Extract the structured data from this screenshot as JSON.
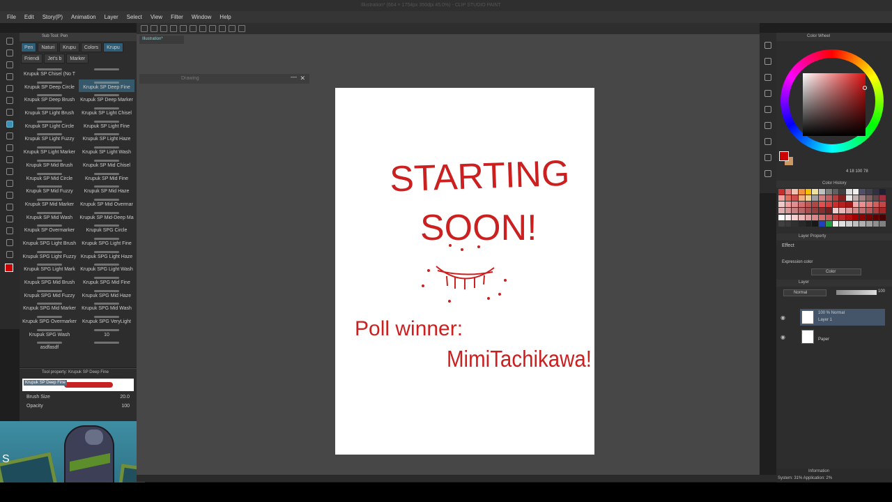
{
  "titlebar": {
    "text": "Illustration* (664 × 1754px 350dpi 45.0%) - CLIP STUDIO PAINT"
  },
  "menu": [
    "File",
    "Edit",
    "Story(P)",
    "Animation",
    "Layer",
    "Select",
    "View",
    "Filter",
    "Window",
    "Help"
  ],
  "document_tab": "Illustration*",
  "floating_window": {
    "title": "Drawing",
    "close": "✕",
    "minimize": "—"
  },
  "subtool": {
    "header": "Sub Tool: Pen",
    "tabs": [
      "Pen",
      "Naturi",
      "Krupu",
      "Colors",
      "Krupu",
      "Friendi",
      "Jet's b",
      "Marker"
    ],
    "active_tab_indices": [
      0,
      4
    ],
    "brushes": [
      [
        "Krupuk SP Chisel (No T",
        ""
      ],
      [
        "Krupuk SP Deep Circle",
        "Krupuk SP Deep Fine"
      ],
      [
        "Krupuk SP Deep Brush",
        "Krupuk SP Deep Marker"
      ],
      [
        "Krupuk SP Light Brush",
        "Krupuk SP Light Chisel"
      ],
      [
        "Krupuk SP Light Circle",
        "Krupuk SP Light Fine"
      ],
      [
        "Krupuk SP Light Fuzzy",
        "Krupuk SP Light Haze"
      ],
      [
        "Krupuk SP Light Marker",
        "Krupuk SP Light Wash"
      ],
      [
        "Krupuk SP Mid Brush",
        "Krupuk SP Mid Chisel"
      ],
      [
        "Krupuk SP Mid Circle",
        "Krupuk SP Mid Fine"
      ],
      [
        "Krupuk SP Mid Fuzzy",
        "Krupuk SP Mid Haze"
      ],
      [
        "Krupuk SP Mid Marker",
        "Krupuk SP Mid Overmar"
      ],
      [
        "Krupuk SP Mid Wash",
        "Krupuk SP Mid-Deep Ma"
      ],
      [
        "Krupuk SP Overmarker",
        "Krupuk SPG Circle"
      ],
      [
        "Krupuk SPG Light Brush",
        "Krupuk SPG Light Fine"
      ],
      [
        "Krupuk SPG Light Fuzzy",
        "Krupuk SPG Light Haze"
      ],
      [
        "Krupuk SPG Light Mark",
        "Krupuk SPG Light Wash"
      ],
      [
        "Krupuk SPG Mid Brush",
        "Krupuk SPG Mid Fine"
      ],
      [
        "Krupuk SPG Mid Fuzzy",
        "Krupuk SPG Mid Haze"
      ],
      [
        "Krupuk SPG Mid Marker",
        "Krupuk SPG Mid Wash"
      ],
      [
        "Krupuk SPG Overmarker",
        "Krupuk SPG VeryLight"
      ],
      [
        "Krupuk SPG Wash",
        "10"
      ],
      [
        "asdfasdf",
        ""
      ]
    ]
  },
  "tool_property": {
    "title": "Tool property: Krupuk SP Deep Fine",
    "brush_name": "Krupuk SP Deep Fine",
    "brush_size_label": "Brush Size",
    "brush_size_value": "20.0",
    "opacity_label": "Opacity",
    "opacity_value": "100"
  },
  "webcam": {
    "overlay_letter": "S"
  },
  "canvas": {
    "line1": "STARTING",
    "line2": "SOON!",
    "line3": "Poll winner:",
    "line4": "MimiTachikawa!",
    "ink_color": "#cc1f1f"
  },
  "color_panel": {
    "header": "Color Wheel",
    "rgb_readout": "4  18  100  78",
    "palette_header": "Color History",
    "palette": [
      "#c83030",
      "#e08080",
      "#f0c0b0",
      "#f09040",
      "#f8c000",
      "#f0e0a0",
      "#c0c0c0",
      "#808080",
      "#606060",
      "#404040",
      "#e0e0e0",
      "#f0f0f0",
      "#505068",
      "#404050",
      "#303040",
      "#202030",
      "#f4a0a0",
      "#e07060",
      "#d05050",
      "#f0b080",
      "#f0d090",
      "#a0a0a0",
      "#d08080",
      "#c06060",
      "#b04040",
      "#802020",
      "#e8e8e8",
      "#c0b0b0",
      "#a08080",
      "#806060",
      "#604848",
      "#a03040",
      "#f0c8c8",
      "#f0a0a0",
      "#e09090",
      "#d07070",
      "#c05858",
      "#b04848",
      "#e05050",
      "#d84040",
      "#c83030",
      "#b82020",
      "#a01818",
      "#f0a8a8",
      "#e89090",
      "#e07878",
      "#d06060",
      "#c04848",
      "#e0b0b0",
      "#d89898",
      "#c88080",
      "#b86868",
      "#a85050",
      "#984040",
      "#883030",
      "#782020",
      "#f2d0d0",
      "#e8b8b8",
      "#dca0a0",
      "#d08888",
      "#c47070",
      "#b85858",
      "#ac4040",
      "#a02828",
      "#ffffff",
      "#fbe8e8",
      "#f4d0d0",
      "#ecb8b8",
      "#e4a0a0",
      "#dc8888",
      "#d47070",
      "#cc5858",
      "#c44040",
      "#bc2828",
      "#b41010",
      "#a80000",
      "#900000",
      "#780000",
      "#600000",
      "#480000",
      "#404040",
      "#3a3a3a",
      "#303030",
      "#282828",
      "#202020",
      "#181818",
      "#2040c0",
      "#20a040",
      "#f0f0f0",
      "#e0e0e0",
      "#d0d0d0",
      "#c0c0c0",
      "#b0b0b0",
      "#a0a0a0",
      "#909090",
      "#808080"
    ],
    "property_header": "Layer Property",
    "effect_label": "Effect",
    "expression_label": "Expression color",
    "expression_value": "Color",
    "layer_header": "Layer",
    "blend_mode": "Normal",
    "opacity": "100",
    "layers": [
      {
        "name_line1": "100 % Normal",
        "name_line2": "Layer 1",
        "selected": true
      },
      {
        "name_line1": "",
        "name_line2": "Paper",
        "selected": false
      }
    ]
  },
  "status": {
    "info": "Information",
    "system": "System: 31%  Application: 2%"
  }
}
